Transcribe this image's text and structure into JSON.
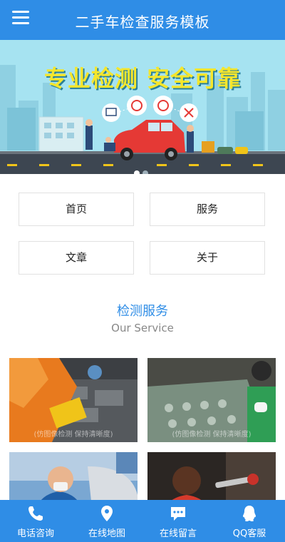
{
  "header": {
    "title": "二手车检查服务模板",
    "menu_icon": "hamburger-menu-icon"
  },
  "banner": {
    "slogan": "专业检测   安全可靠",
    "slides_count": 2,
    "active_slide": 1
  },
  "nav": {
    "items": [
      {
        "label": "首页"
      },
      {
        "label": "服务"
      },
      {
        "label": "文章"
      },
      {
        "label": "关于"
      }
    ]
  },
  "section": {
    "title": "检测服务",
    "subtitle": "Our Service"
  },
  "services": {
    "watermark": "(仿图像检测 保持清晰度)"
  },
  "footer": {
    "items": [
      {
        "label": "电话咨询",
        "icon": "phone-icon"
      },
      {
        "label": "在线地图",
        "icon": "map-pin-icon"
      },
      {
        "label": "在线留言",
        "icon": "message-icon"
      },
      {
        "label": "QQ客服",
        "icon": "qq-icon"
      }
    ]
  },
  "colors": {
    "primary": "#2f8de6",
    "slogan": "#f5e62c",
    "sky": "#a6e3f1"
  }
}
